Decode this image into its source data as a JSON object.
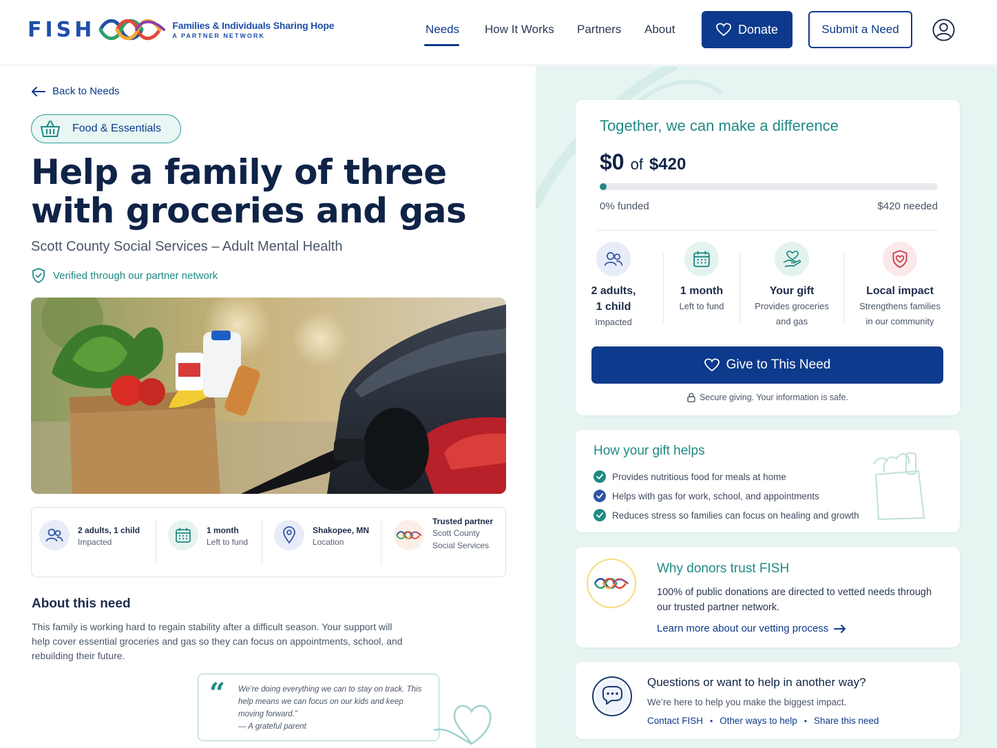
{
  "header": {
    "logo_word": "FISH",
    "logo_line1": "Families & Individuals Sharing Hope",
    "logo_line2": "A PARTNER NETWORK",
    "nav": [
      "Needs",
      "How It Works",
      "Partners",
      "About"
    ],
    "donate_label": "Donate",
    "submit_label": "Submit a Need"
  },
  "need": {
    "back_label": "Back to Needs",
    "category": "Food & Essentials",
    "title": "Help a family of three with groceries and gas",
    "subtitle": "Scott County Social Services – Adult Mental Health",
    "verified": "Verified through our partner network"
  },
  "stats": {
    "people_title": "2 adults, 1 child",
    "people_sub": "Impacted",
    "time_title": "1 month",
    "time_sub": "Left to fund",
    "location_title": "Shakopee, MN",
    "location_sub": "Location",
    "partner_title": "Trusted partner",
    "partner_sub_1": "Scott County",
    "partner_sub_2": "Social Services"
  },
  "about": {
    "heading": "About this need",
    "body": "This family is working hard to regain stability after a difficult season. Your support will help cover essential groceries and gas so they can focus on appointments, school, and rebuilding their future.",
    "quote": "We’re doing everything we can to stay on track. This help means we can focus on our kids and keep moving forward.”",
    "quote_author": "— A grateful parent"
  },
  "donation": {
    "heading": "Together, we can make a difference",
    "raised": "$0",
    "of": "of",
    "goal": "$420",
    "funded_fraction": 0,
    "funded_label": "0% funded",
    "needed_label": "$420 needed",
    "impact": [
      {
        "title_1": "2 adults,",
        "title_2": "1 child",
        "sub_1": "Impacted",
        "sub_2": ""
      },
      {
        "title_1": "1 month",
        "title_2": "",
        "sub_1": "Left to fund",
        "sub_2": ""
      },
      {
        "title_1": "Your gift",
        "title_2": "",
        "sub_1": "Provides groceries",
        "sub_2": "and gas"
      },
      {
        "title_1": "Local impact",
        "title_2": "",
        "sub_1": "Strengthens families",
        "sub_2": "in our community"
      }
    ],
    "give_label": "Give to This Need",
    "secure_label": "Secure giving. Your information is safe."
  },
  "helps": {
    "heading": "How your gift helps",
    "items": [
      "Provides nutritious food for meals at home",
      "Helps with gas for work, school, and appointments",
      "Reduces stress so families can focus on healing and growth"
    ]
  },
  "trust": {
    "heading": "Why donors trust FISH",
    "body": "100% of public donations are directed to vetted needs through our trusted partner network.",
    "link": "Learn more about our vetting process"
  },
  "questions": {
    "heading": "Questions or want to help in another way?",
    "body": "We’re here to help you make the biggest impact.",
    "links": [
      "Contact FISH",
      "Other ways to help",
      "Share this need"
    ]
  },
  "colors": {
    "primary": "#0d3a8c",
    "teal": "#1f8a84",
    "panel": "#e6f4f2"
  }
}
